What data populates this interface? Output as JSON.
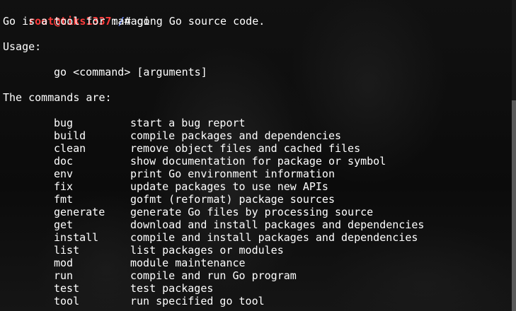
{
  "prompt": {
    "user_host": "root@tiks1337",
    "separator": ":",
    "path": "/",
    "symbol": "# ",
    "command": "go"
  },
  "output": {
    "intro": "Go is a tool for managing Go source code.",
    "usage_label": "Usage:",
    "usage_line": "go <command> [arguments]",
    "commands_label": "The commands are:"
  },
  "commands": [
    {
      "name": "bug",
      "desc": "start a bug report"
    },
    {
      "name": "build",
      "desc": "compile packages and dependencies"
    },
    {
      "name": "clean",
      "desc": "remove object files and cached files"
    },
    {
      "name": "doc",
      "desc": "show documentation for package or symbol"
    },
    {
      "name": "env",
      "desc": "print Go environment information"
    },
    {
      "name": "fix",
      "desc": "update packages to use new APIs"
    },
    {
      "name": "fmt",
      "desc": "gofmt (reformat) package sources"
    },
    {
      "name": "generate",
      "desc": "generate Go files by processing source"
    },
    {
      "name": "get",
      "desc": "download and install packages and dependencies"
    },
    {
      "name": "install",
      "desc": "compile and install packages and dependencies"
    },
    {
      "name": "list",
      "desc": "list packages or modules"
    },
    {
      "name": "mod",
      "desc": "module maintenance"
    },
    {
      "name": "run",
      "desc": "compile and run Go program"
    },
    {
      "name": "test",
      "desc": "test packages"
    },
    {
      "name": "tool",
      "desc": "run specified go tool"
    }
  ],
  "colors": {
    "prompt_user": "#ff3b3b",
    "prompt_path": "#6b8cff",
    "text": "#ffffff"
  }
}
